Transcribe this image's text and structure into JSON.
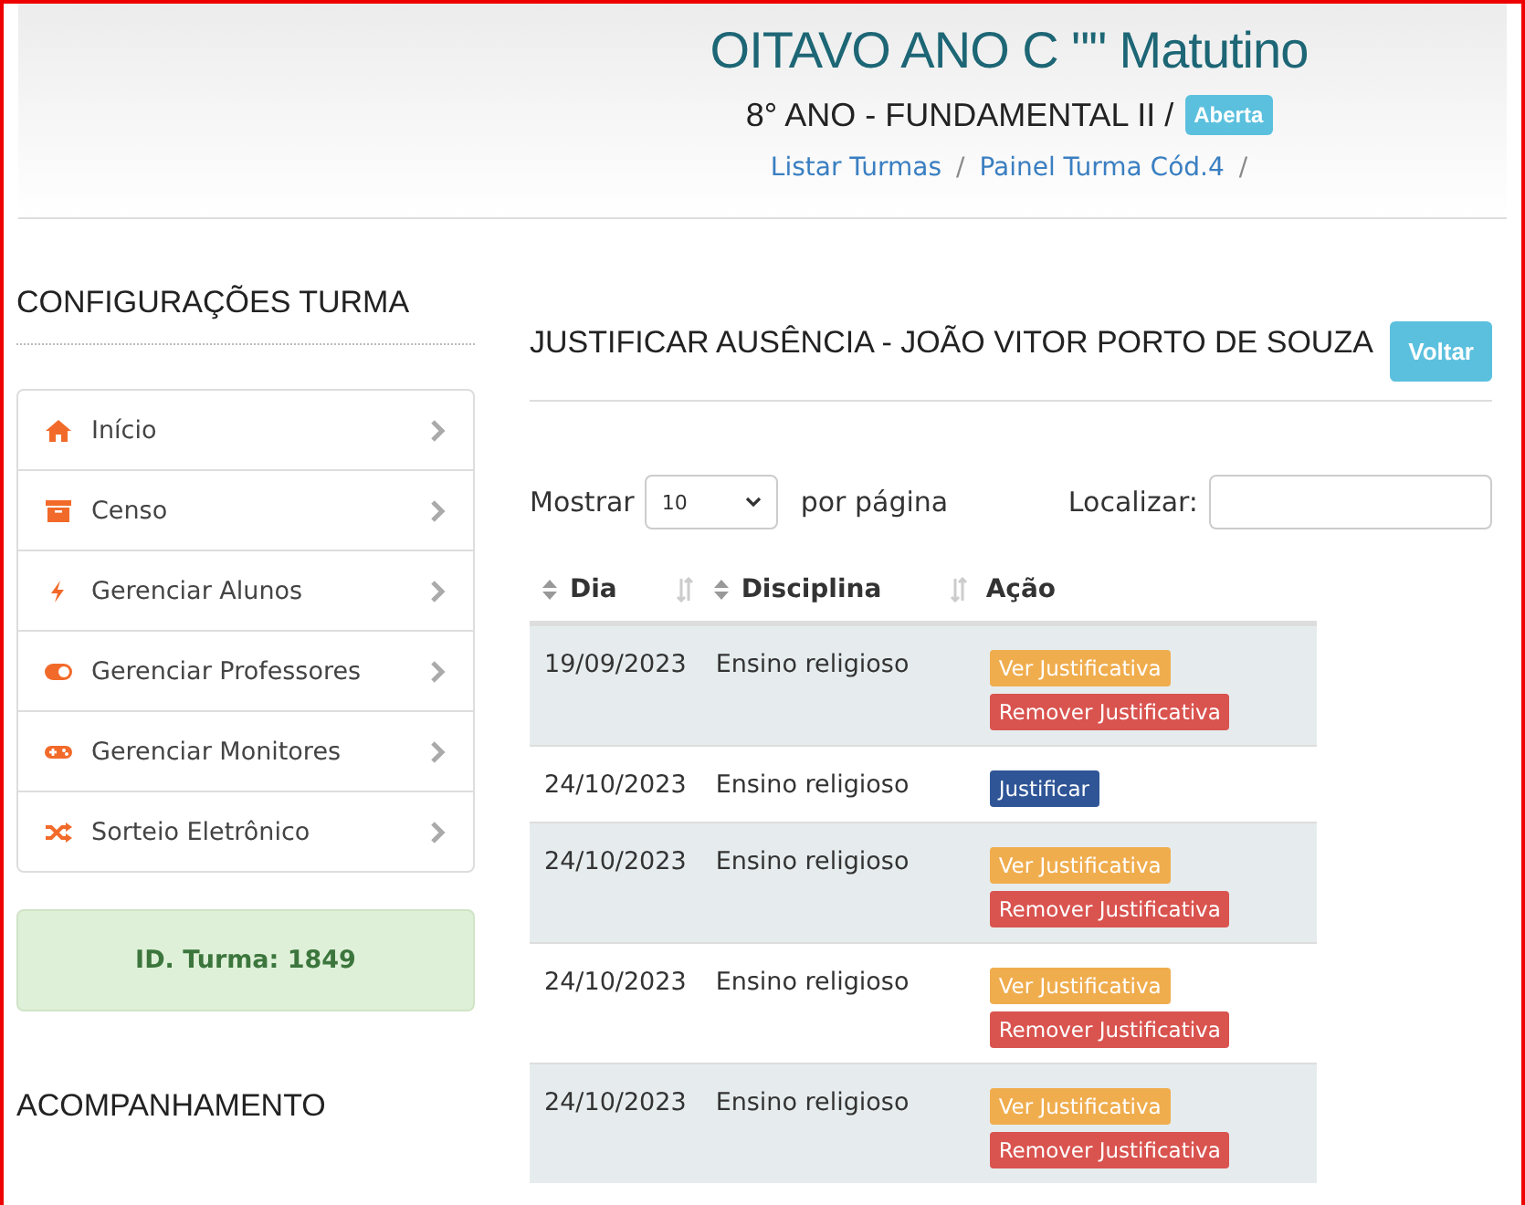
{
  "header": {
    "title": "OITAVO ANO C \"\" Matutino",
    "subtitle": "8° ANO - FUNDAMENTAL II /",
    "status_badge": "Aberta",
    "breadcrumb": [
      {
        "label": "Listar Turmas",
        "separator": "/"
      },
      {
        "label": "Painel Turma Cód.4",
        "separator": "/"
      }
    ]
  },
  "sidebar": {
    "title": "CONFIGURAÇÕES TURMA",
    "items": [
      {
        "label": "Início"
      },
      {
        "label": "Censo"
      },
      {
        "label": "Gerenciar Alunos"
      },
      {
        "label": "Gerenciar Professores"
      },
      {
        "label": "Gerenciar Monitores"
      },
      {
        "label": "Sorteio Eletrônico"
      }
    ],
    "id_box": "ID. Turma: 1849",
    "section_title": "ACOMPANHAMENTO"
  },
  "main": {
    "heading": "JUSTIFICAR AUSÊNCIA - JOÃO VITOR PORTO DE SOUZA",
    "back_button": "Voltar",
    "length_label": "Mostrar",
    "length_value": "10",
    "length_suffix": "por página",
    "search_label": "Localizar:",
    "table": {
      "columns": [
        {
          "label": "Dia",
          "sortable": true
        },
        {
          "label": "Disciplina",
          "sortable": true
        },
        {
          "label": "Ação",
          "sortable": false
        }
      ],
      "rows": [
        {
          "date": "19/09/2023",
          "subject": "Ensino religioso",
          "actions": [
            {
              "label": "Ver Justificativa",
              "kind": "view"
            },
            {
              "label": "Remover Justificativa",
              "kind": "remove"
            }
          ]
        },
        {
          "date": "24/10/2023",
          "subject": "Ensino religioso",
          "actions": [
            {
              "label": "Justificar",
              "kind": "justify"
            }
          ]
        },
        {
          "date": "24/10/2023",
          "subject": "Ensino religioso",
          "actions": [
            {
              "label": "Ver Justificativa",
              "kind": "view"
            },
            {
              "label": "Remover Justificativa",
              "kind": "remove"
            }
          ]
        },
        {
          "date": "24/10/2023",
          "subject": "Ensino religioso",
          "actions": [
            {
              "label": "Ver Justificativa",
              "kind": "view"
            },
            {
              "label": "Remover Justificativa",
              "kind": "remove"
            }
          ]
        },
        {
          "date": "24/10/2023",
          "subject": "Ensino religioso",
          "actions": [
            {
              "label": "Ver Justificativa",
              "kind": "view"
            },
            {
              "label": "Remover Justificativa",
              "kind": "remove"
            }
          ]
        }
      ]
    }
  }
}
